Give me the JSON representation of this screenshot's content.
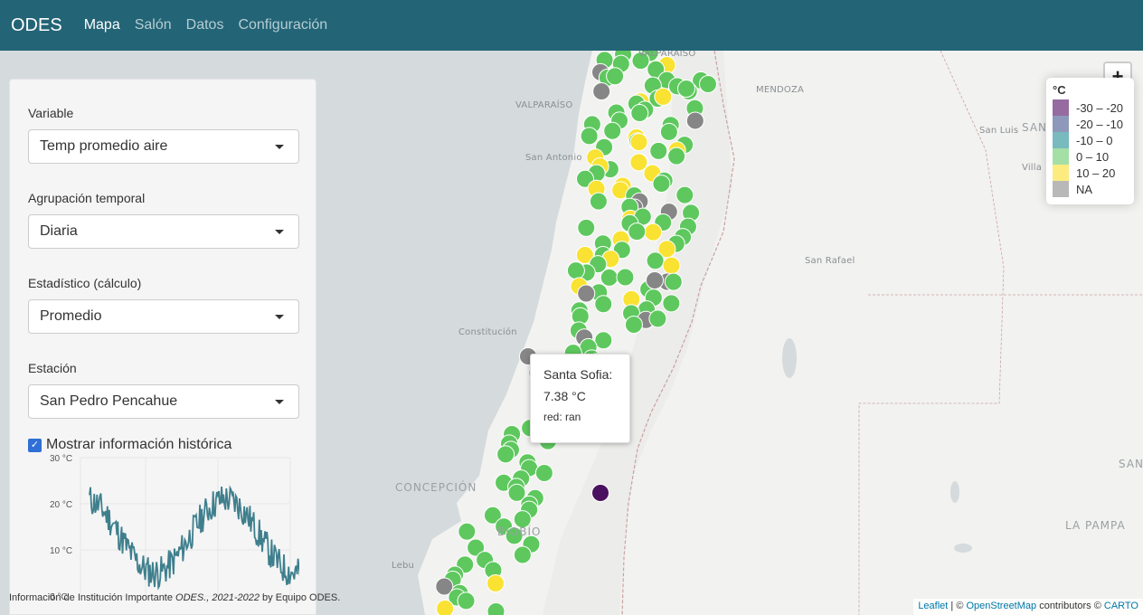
{
  "navbar": {
    "brand": "ODES",
    "items": [
      {
        "label": "Mapa",
        "active": true
      },
      {
        "label": "Salón",
        "active": false
      },
      {
        "label": "Datos",
        "active": false
      },
      {
        "label": "Configuración",
        "active": false
      }
    ]
  },
  "panel": {
    "variable_label": "Variable",
    "variable_value": "Temp promedio aire",
    "grouping_label": "Agrupación temporal",
    "grouping_value": "Diaria",
    "stat_label": "Estadístico (cálculo)",
    "stat_value": "Promedio",
    "station_label": "Estación",
    "station_value": "San Pedro Pencahue",
    "history_label": "Mostrar información histórica",
    "history_checked": true
  },
  "history_chart": {
    "type": "line",
    "y_ticks": [
      "30 °C",
      "20 °C",
      "10 °C",
      "0 °C"
    ],
    "ylim": [
      0,
      30
    ],
    "color": "#3f7f8d"
  },
  "map_labels": {
    "valparaiso_region": "VALPARAÍSO",
    "valparaiso": "VALPARAÍSO",
    "mendoza": "MENDOZA",
    "san_luis_prov": "SAN LUIS",
    "san_luis": "San Luis",
    "villa": "Villa",
    "san_antonio": "San Antonio",
    "san_rafael": "San Rafael",
    "constitucion": "Constitución",
    "concepcion": "CONCEPCIÓN",
    "biobio": "BIOBÍO",
    "lebu": "Lebu",
    "la_pampa": "LA PAMPA",
    "santa_rosa": "SANT"
  },
  "zoom": {
    "in": "+",
    "out": "−"
  },
  "legend": {
    "title": "°C",
    "items": [
      {
        "label": "-30 – -20",
        "color": "#6a2c78"
      },
      {
        "label": "-20 – -10",
        "color": "#5e6c9c"
      },
      {
        "label": "-10 – 0",
        "color": "#3f9ca3"
      },
      {
        "label": "0 – 10",
        "color": "#7dd180"
      },
      {
        "label": "10 – 20",
        "color": "#fbe44a"
      },
      {
        "label": "NA",
        "color": "#9a9a9a"
      }
    ]
  },
  "tooltip": {
    "station": "Santa Sofia:",
    "value": "7.38 °C",
    "network": "red: ran"
  },
  "attribution": {
    "left_pre": "Información de Institución Importante ",
    "left_em": "ODES., 2021-2022",
    "left_post": " by Equipo ODES.",
    "leaflet": "Leaflet",
    "sep1": " | © ",
    "osm": "OpenStreetMap",
    "contrib": " contributors © ",
    "carto": "CARTO"
  },
  "marker_colors": {
    "green": "#5ec85e",
    "yellow": "#f9e232",
    "gray": "#868686",
    "purple": "#4a1160"
  }
}
